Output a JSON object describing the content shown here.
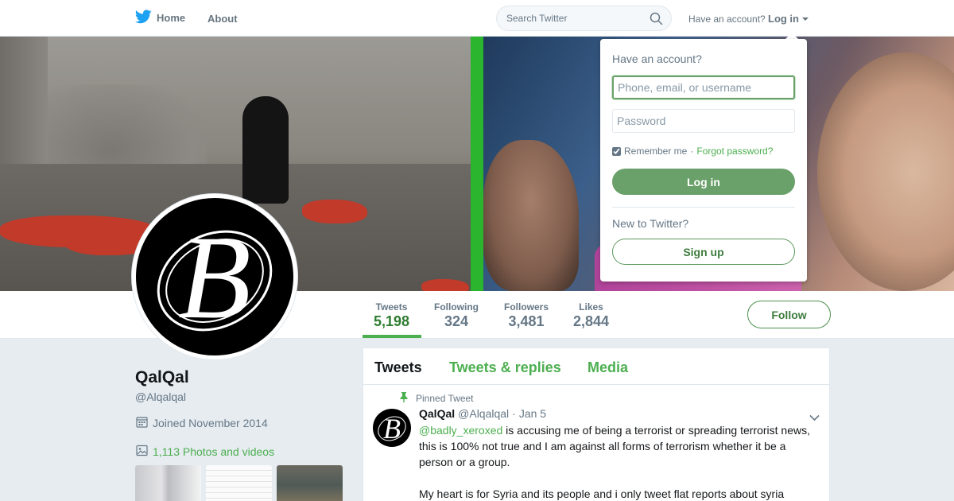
{
  "colors": {
    "accent": "#4caf50",
    "accent_dark": "#3d7c3d",
    "login_button": "#6aa06a",
    "banner_green_stripe": "#2bb42e"
  },
  "nav": {
    "logo_icon": "twitter-bird-icon",
    "home_label": "Home",
    "about_label": "About",
    "search_placeholder": "Search Twitter",
    "search_icon": "search-icon",
    "account_question": "Have an account?",
    "login_label": "Log in"
  },
  "profile": {
    "name": "QalQal",
    "handle": "@Alqalqal",
    "joined": "Joined November 2014",
    "photos_link": "1,113 Photos and videos",
    "avatar_letter": "B"
  },
  "stats": [
    {
      "label": "Tweets",
      "value": "5,198",
      "active": true
    },
    {
      "label": "Following",
      "value": "324",
      "active": false
    },
    {
      "label": "Followers",
      "value": "3,481",
      "active": false
    },
    {
      "label": "Likes",
      "value": "2,844",
      "active": false
    }
  ],
  "follow_label": "Follow",
  "timeline": {
    "tabs": [
      "Tweets",
      "Tweets & replies",
      "Media"
    ],
    "active_tab": "Tweets",
    "pinned_label": "Pinned Tweet",
    "tweet": {
      "name": "QalQal",
      "handle": "@Alqalqal",
      "dot": "·",
      "date": "Jan 5",
      "mention": "@badly_xeroxed",
      "text_after_mention": " is accusing me of being a terrorist or spreading terrorist news, this is 100% not true and I am against all forms of terrorism whether it be a person or a group.",
      "text_para2": "My heart is for Syria and its people and i only tweet flat reports about syria"
    }
  },
  "login_dropdown": {
    "title": "Have an account?",
    "username_placeholder": "Phone, email, or username",
    "password_placeholder": "Password",
    "remember_label": "Remember me",
    "separator": "·",
    "forgot_label": "Forgot password?",
    "remember_checked": true,
    "login_button": "Log in",
    "new_label": "New to Twitter?",
    "signup_button": "Sign up"
  }
}
